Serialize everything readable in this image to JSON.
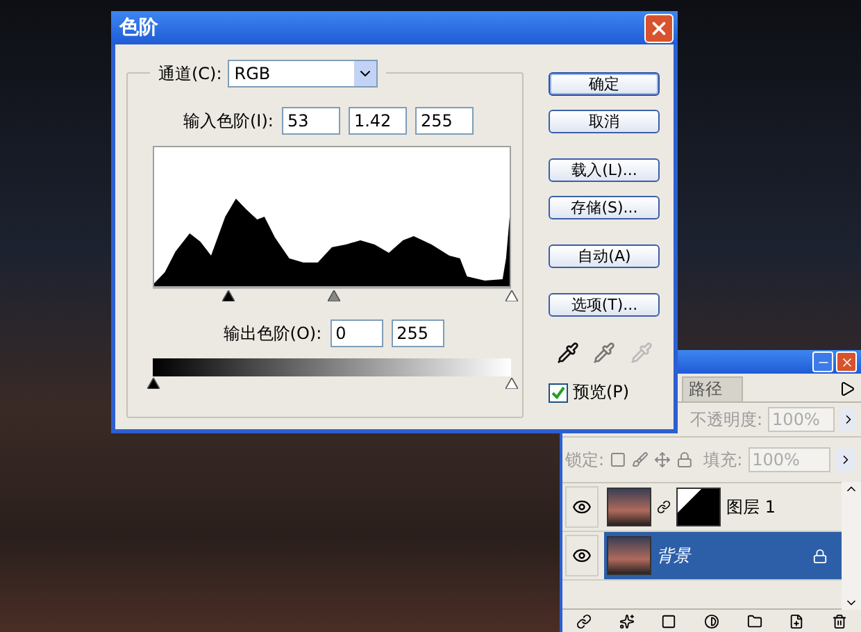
{
  "dialog": {
    "title": "色阶",
    "channel": {
      "label": "通道(C):",
      "value": "RGB"
    },
    "input_levels": {
      "label": "输入色阶(I):",
      "values": [
        "53",
        "1.42",
        "255"
      ]
    },
    "output_levels": {
      "label": "输出色阶(O):",
      "values": [
        "0",
        "255"
      ]
    },
    "button_groups": [
      [
        {
          "label": "确定",
          "default": true
        },
        {
          "label": "取消",
          "default": false
        }
      ],
      [
        {
          "label": "载入(L)...",
          "default": false
        },
        {
          "label": "存储(S)...",
          "default": false
        }
      ],
      [
        {
          "label": "自动(A)",
          "default": false
        }
      ],
      [
        {
          "label": "选项(T)...",
          "default": false
        }
      ]
    ],
    "preview": {
      "label": "预览(P)",
      "checked": true
    }
  },
  "layers_panel": {
    "tab": "路径",
    "opacity": {
      "label": "不透明度:",
      "value": "100%",
      "disabled": true
    },
    "lock_label": "锁定:",
    "fill": {
      "label": "填充:",
      "value": "100%",
      "disabled": true
    },
    "layers": [
      {
        "name": "图层 1",
        "selected": false,
        "has_mask": true,
        "locked": false
      },
      {
        "name": "背景",
        "selected": true,
        "has_mask": false,
        "locked": true
      }
    ]
  }
}
